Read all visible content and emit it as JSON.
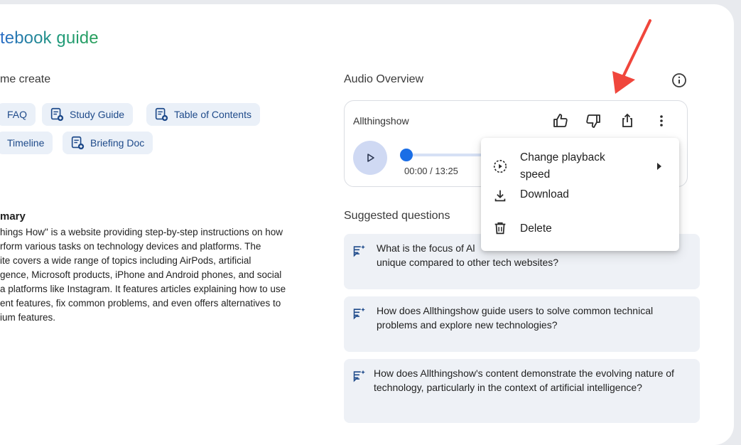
{
  "left": {
    "title": "tebook guide",
    "create_heading": "me create",
    "chips": [
      {
        "label": "FAQ",
        "icon": "faq-icon"
      },
      {
        "label": "Study Guide",
        "icon": "document-add-icon"
      },
      {
        "label": "Table of Contents",
        "icon": "document-add-icon"
      },
      {
        "label": "Timeline",
        "icon": "timeline-icon"
      },
      {
        "label": "Briefing Doc",
        "icon": "document-add-icon"
      }
    ],
    "summary_heading": "mary",
    "summary_lines": [
      "hings How\" is a website providing step-by-step instructions on how",
      "rform various tasks on technology devices and platforms. The",
      "ite covers a wide range of topics including AirPods, artificial",
      "gence, Microsoft products, iPhone and Android phones, and social",
      "a platforms like Instagram. It features articles explaining how to use",
      "ent features, fix common problems, and even offers alternatives to",
      "ium features."
    ]
  },
  "audio": {
    "heading": "Audio Overview",
    "name": "Allthingshow",
    "time": "00:00 / 13:25",
    "progress": 0,
    "icons": [
      "thumbs-up-icon",
      "thumbs-down-icon",
      "share-icon",
      "more-vert-icon",
      "info-icon",
      "play-icon"
    ]
  },
  "menu": {
    "items": [
      {
        "label": "Change playback\nspeed",
        "icon": "playback-speed-icon",
        "submenu": true
      },
      {
        "label": "Download",
        "icon": "download-icon"
      },
      {
        "label": "Delete",
        "icon": "trash-icon"
      }
    ]
  },
  "suggested": {
    "heading": "Suggested questions",
    "questions": [
      "What is the focus of Al… unique compared to other tech websites?",
      "How does Allthingshow guide users to solve common technical problems and explore new technologies?",
      "How does Allthingshow's content demonstrate the evolving nature of technology, particularly in the context of artificial intelligence?"
    ],
    "q1_visible_top": "What is the focus of Al",
    "q1_visible_bottom": "unique compared to other tech websites?"
  },
  "colors": {
    "accent": "#1a6ee6",
    "chip_bg": "#eaf0f8",
    "chip_text": "#1e4a8a",
    "annotation_arrow": "#f0463c"
  }
}
